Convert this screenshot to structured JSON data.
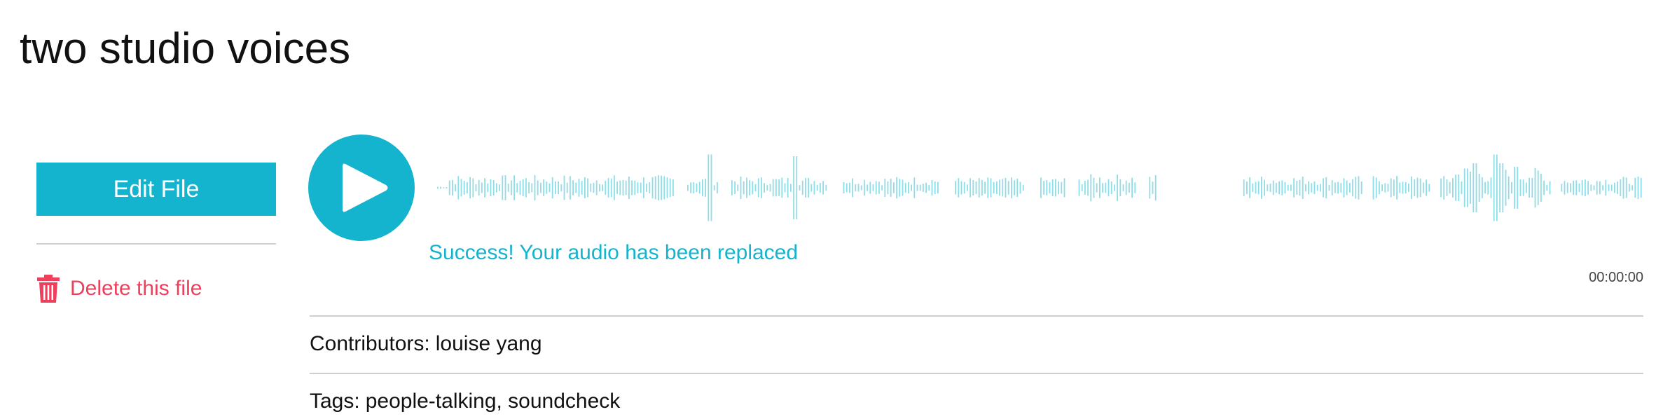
{
  "page": {
    "title": "two studio voices"
  },
  "sidebar": {
    "edit_label": "Edit File",
    "delete_label": "Delete this file"
  },
  "player": {
    "status_message": "Success! Your audio has been replaced",
    "current_time": "00:00:00"
  },
  "details": {
    "contributors_label": "Contributors:",
    "contributors_value": "louise yang",
    "tags_label": "Tags:",
    "tags_value": "people-talking, soundcheck"
  },
  "colors": {
    "accent": "#14b4cf",
    "waveform": "#8fdde6",
    "danger": "#ee3f5c"
  },
  "icons": {
    "play": "play-icon",
    "delete": "trash-icon"
  }
}
